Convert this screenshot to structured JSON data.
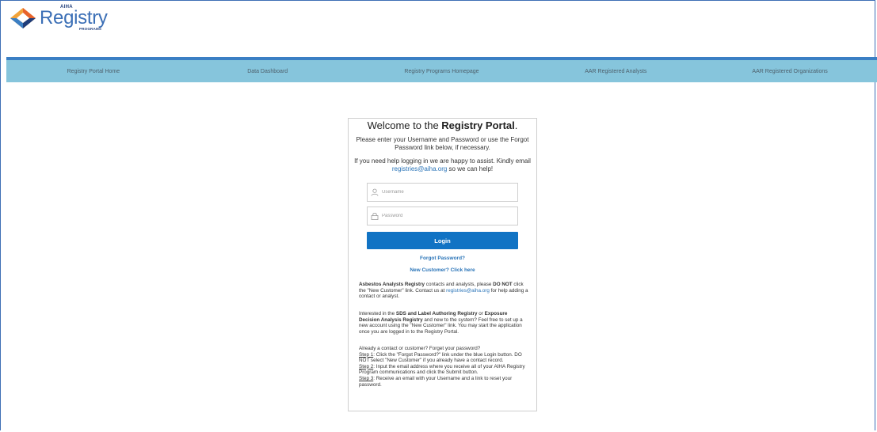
{
  "header": {
    "logo_small": "AIHA",
    "logo_main": "Registry",
    "logo_sub": "PROGRAMS"
  },
  "nav": {
    "items": [
      {
        "label": "Registry Portal Home"
      },
      {
        "label": "Data Dashboard"
      },
      {
        "label": "Registry Programs Homepage"
      },
      {
        "label": "AAR Registered Analysts"
      },
      {
        "label": "AAR Registered Organizations"
      }
    ]
  },
  "login": {
    "title_prefix": "Welcome to the ",
    "title_bold": "Registry Portal",
    "title_suffix": ".",
    "intro": "Please enter your Username and Password or use the Forgot Password link below, if necessary.",
    "help_text": "If you need help logging in we are happy to assist. Kindly email",
    "help_email": "registries@aiha.org",
    "help_suffix": " so we can help!",
    "username_placeholder": "Username",
    "password_placeholder": "Password",
    "login_label": "Login",
    "forgot_label": "Forgot Password?",
    "new_customer_label": "New Customer? Click here"
  },
  "info": {
    "p1_bold1": "Asbestos Analysts Registry",
    "p1_text1": " contacts and analysts, please ",
    "p1_bold2": "DO NOT",
    "p1_text2": " click the \"New Customer\" link. Contact us at ",
    "p1_email": "registries@aiha.org",
    "p1_text3": " for help adding a contact or analyst.",
    "p2_text1": "Interested in the ",
    "p2_bold1": "SDS and Label Authoring Registry",
    "p2_text2": " or ",
    "p2_bold2": "Exposure Decision Analysis Registry",
    "p2_text3": " and new to the system? Feel free to set up a new account using the \"New Customer\" link. You may start the application once you are logged in to the Registry Portal.",
    "p3_intro": "Already a contact or customer? Forget your password?",
    "step1_label": "Step 1",
    "step1_text": ": Click the \"Forgot Password?\" link under the blue Login button. DO NOT select \"New Customer\" if you already have a contact record.",
    "step2_label": "Step 2",
    "step2_text": ": Input the email address where you receive all of your AIHA Registry Program communications and click the Submit button.",
    "step3_label": "Step 3",
    "step3_text": ": Receive an email with your Username and a link to reset your password."
  },
  "colors": {
    "nav_bg": "#86c5dc",
    "top_bar": "#3b7fc4",
    "login_button": "#1173c4",
    "link": "#2a74b8"
  }
}
